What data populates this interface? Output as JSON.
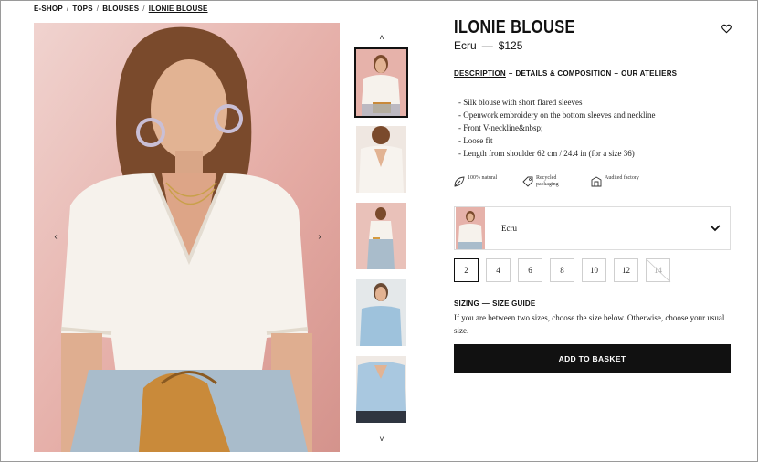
{
  "breadcrumb": [
    "E-SHOP",
    "TOPS",
    "BLOUSES",
    "ILONIE BLOUSE"
  ],
  "breadcrumb_separator": "/",
  "product": {
    "title": "ILONIE BLOUSE",
    "color": "Ecru",
    "price": "$125",
    "price_dash": "—"
  },
  "tabs": {
    "description": "DESCRIPTION",
    "sep": "–",
    "details": "DETAILS & COMPOSITION",
    "ateliers": "OUR ATELIERS"
  },
  "details": [
    "- Silk blouse with short flared sleeves",
    "- Openwork embroidery on the bottom sleeves and neckline",
    "- Front V-neckline&nbsp;",
    "- Loose fit",
    "- Length from shoulder 62 cm / 24.4 in (for a size 36)"
  ],
  "badges": [
    {
      "icon": "leaf-icon",
      "text": "100% natural"
    },
    {
      "icon": "tag-icon",
      "text": "Recycled packaging"
    },
    {
      "icon": "factory-icon",
      "text": "Audited factory"
    }
  ],
  "color_select": {
    "value": "Ecru"
  },
  "sizes": [
    {
      "label": "2",
      "state": "selected"
    },
    {
      "label": "4",
      "state": "available"
    },
    {
      "label": "6",
      "state": "available"
    },
    {
      "label": "8",
      "state": "available"
    },
    {
      "label": "10",
      "state": "available"
    },
    {
      "label": "12",
      "state": "available"
    },
    {
      "label": "14",
      "state": "unavailable"
    }
  ],
  "sizing": {
    "label": "SIZING",
    "sep": "—",
    "guide": "SIZE GUIDE",
    "help": "If you are between two sizes, choose the size below. Otherwise, choose your usual size."
  },
  "add_to_basket": "ADD TO BASKET",
  "nav": {
    "prev": "‹",
    "next": "›",
    "up": "˄",
    "down": "˅"
  },
  "colors": {
    "button_bg": "#111111",
    "photo_pink": "#e8b7b0"
  }
}
